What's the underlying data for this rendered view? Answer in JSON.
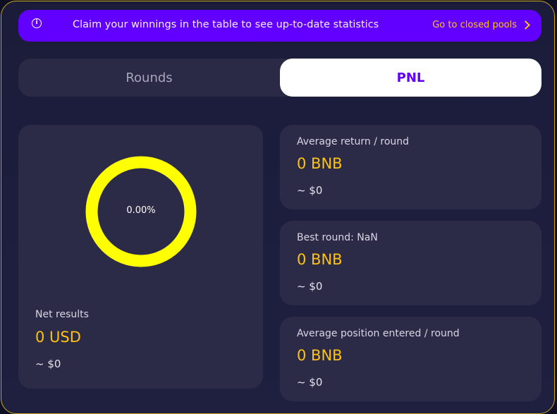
{
  "banner": {
    "icon": "info-icon",
    "text": "Claim your winnings in the table to see up-to-date statistics",
    "link_label": "Go to closed pools",
    "link_icon": "chevron-right-icon",
    "color": "#6200ff"
  },
  "tabs": [
    {
      "label": "Rounds",
      "active": false
    },
    {
      "label": "PNL",
      "active": true
    }
  ],
  "net_results": {
    "percent_label": "0.00%",
    "ring_color": "#ffff00",
    "title": "Net results",
    "value": "0 USD",
    "usd": "~ $0"
  },
  "stats": [
    {
      "title": "Average return / round",
      "value": "0 BNB",
      "usd": "~ $0"
    },
    {
      "title": "Best round: NaN",
      "value": "0 BNB",
      "usd": "~ $0"
    },
    {
      "title": "Average position entered / round",
      "value": "0 BNB",
      "usd": "~ $0"
    }
  ],
  "colors": {
    "accent": "#6200ff",
    "value": "#ffc20f",
    "background": "#1b1b3a",
    "card": "#2b2a47"
  }
}
